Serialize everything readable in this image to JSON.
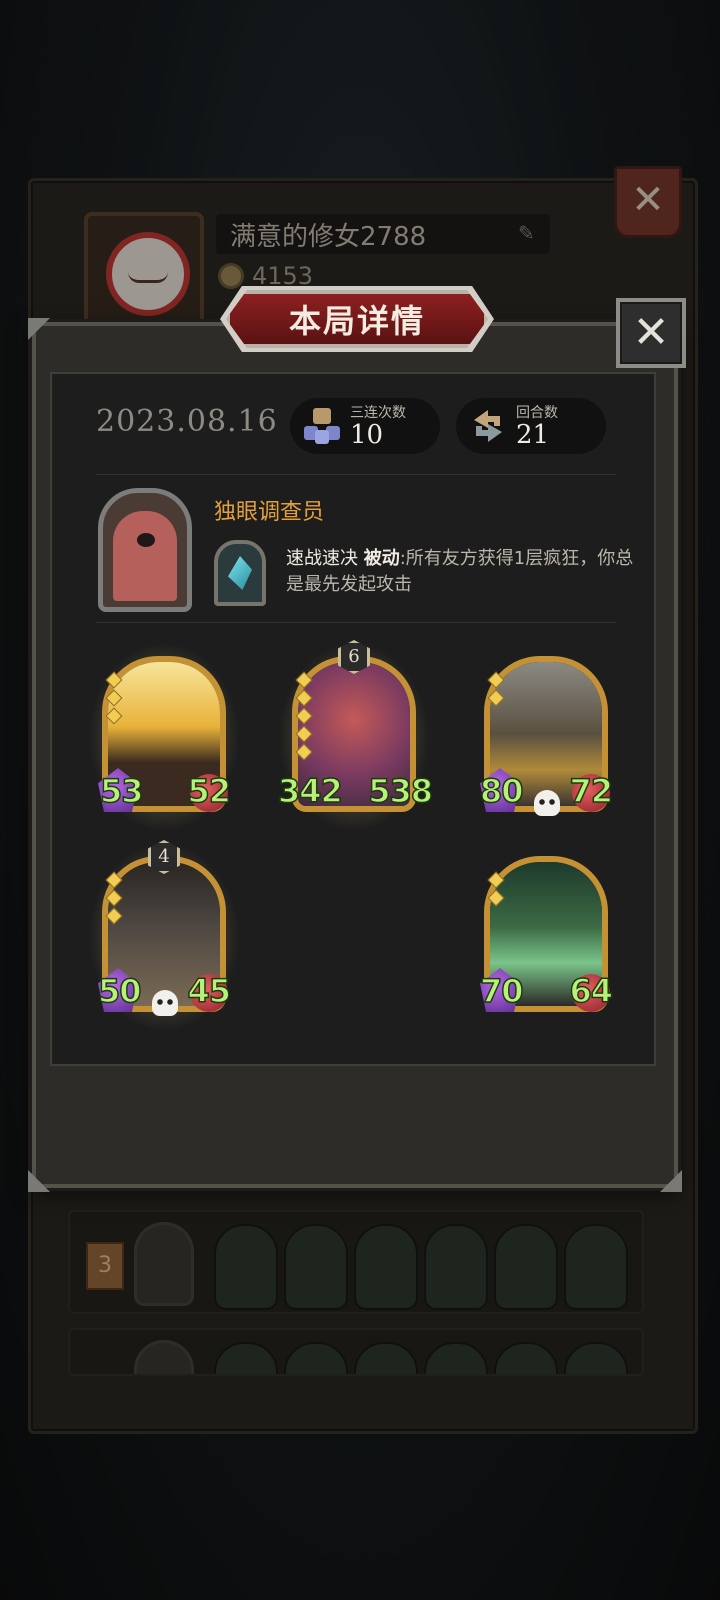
{
  "profile": {
    "player_name": "满意的修女2788",
    "score": "4153",
    "history_rank": "3"
  },
  "dialog": {
    "title": "本局详情",
    "close_icon": "close-icon",
    "date": "2023.08.16",
    "stats": [
      {
        "label": "三连次数",
        "value": "10",
        "icon": "triple-merge-icon"
      },
      {
        "label": "回合数",
        "value": "21",
        "icon": "round-cycle-icon"
      }
    ],
    "hero": {
      "name": "独眼调查员",
      "skill_name": "速战速决",
      "skill_type": "被动",
      "skill_desc": ":所有友方获得1层疯狂，你总是最先发起攻击"
    },
    "units": [
      {
        "attack": "53",
        "health": "52",
        "level": "",
        "dead": false,
        "golden": true
      },
      {
        "attack": "342",
        "health": "538",
        "level": "6",
        "dead": false,
        "golden": true
      },
      {
        "attack": "80",
        "health": "72",
        "level": "",
        "dead": true,
        "golden": false
      },
      {
        "attack": "50",
        "health": "45",
        "level": "4",
        "dead": true,
        "golden": true
      },
      {
        "attack": "70",
        "health": "64",
        "level": "",
        "dead": false,
        "golden": false
      }
    ]
  },
  "colors": {
    "title_banner": "#8d2020",
    "hero_name": "#e3a03a",
    "stat_number": "#b8f07a",
    "card_frame": "#c49235"
  }
}
